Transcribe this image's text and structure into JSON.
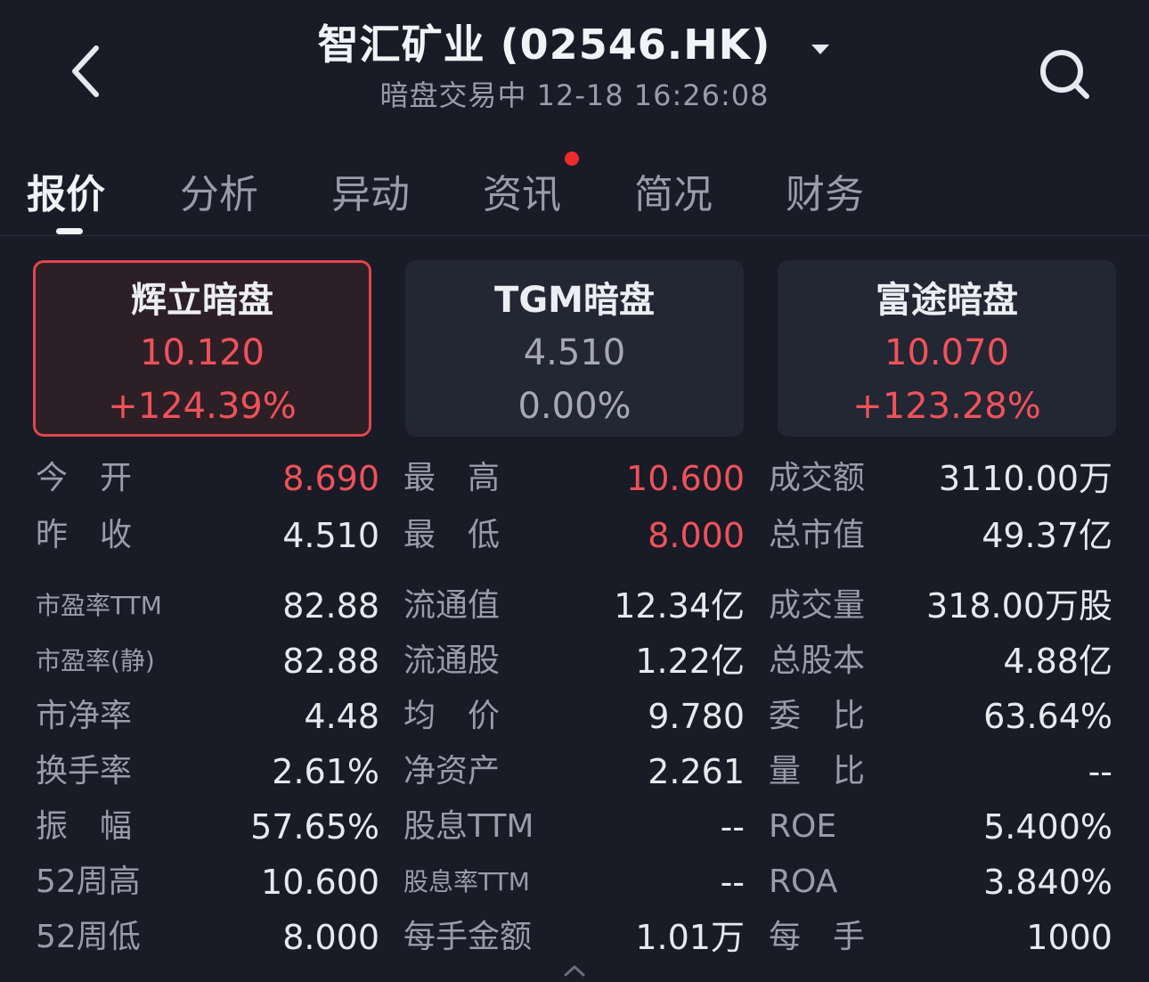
{
  "header": {
    "title": "智汇矿业 (02546.HK)",
    "status": "暗盘交易中 12-18 16:26:08"
  },
  "tabs": [
    {
      "label": "报价",
      "active": true
    },
    {
      "label": "分析"
    },
    {
      "label": "异动"
    },
    {
      "label": "资讯",
      "dot": true
    },
    {
      "label": "简况"
    },
    {
      "label": "财务"
    }
  ],
  "cards": [
    {
      "name": "辉立暗盘",
      "price": "10.120",
      "change": "+124.39%",
      "trend": "up",
      "selected": true
    },
    {
      "name": "TGM暗盘",
      "price": "4.510",
      "change": "0.00%",
      "trend": "flat"
    },
    {
      "name": "富途暗盘",
      "price": "10.070",
      "change": "+123.28%",
      "trend": "up"
    }
  ],
  "stats": {
    "col1": [
      {
        "label": "今　开",
        "value": "8.690",
        "up": true
      },
      {
        "label": "昨　收",
        "value": "4.510"
      },
      {
        "label": "市盈率TTM",
        "value": "82.88",
        "small": true
      },
      {
        "label": "市盈率(静)",
        "value": "82.88",
        "small": true
      },
      {
        "label": "市净率",
        "value": "4.48"
      },
      {
        "label": "换手率",
        "value": "2.61%"
      },
      {
        "label": "振　幅",
        "value": "57.65%"
      },
      {
        "label": "52周高",
        "value": "10.600"
      },
      {
        "label": "52周低",
        "value": "8.000"
      }
    ],
    "col2": [
      {
        "label": "最　高",
        "value": "10.600",
        "up": true
      },
      {
        "label": "最　低",
        "value": "8.000",
        "up": true
      },
      {
        "label": "流通值",
        "value": "12.34亿"
      },
      {
        "label": "流通股",
        "value": "1.22亿"
      },
      {
        "label": "均　价",
        "value": "9.780"
      },
      {
        "label": "净资产",
        "value": "2.261"
      },
      {
        "label": "股息TTM",
        "value": "--"
      },
      {
        "label": "股息率TTM",
        "value": "--",
        "small": true
      },
      {
        "label": "每手金额",
        "value": "1.01万"
      }
    ],
    "col3": [
      {
        "label": "成交额",
        "value": "3110.00万"
      },
      {
        "label": "总市值",
        "value": "49.37亿"
      },
      {
        "label": "成交量",
        "value": "318.00万股"
      },
      {
        "label": "总股本",
        "value": "4.88亿"
      },
      {
        "label": "委　比",
        "value": "63.64%"
      },
      {
        "label": "量　比",
        "value": "--"
      },
      {
        "label": "ROE",
        "value": "5.400%"
      },
      {
        "label": "ROA",
        "value": "3.840%"
      },
      {
        "label": "每　手",
        "value": "1000"
      }
    ]
  },
  "colors": {
    "background": "#191b26",
    "up": "#f0525a",
    "card": "#232633",
    "selected_border": "#e2464e"
  }
}
